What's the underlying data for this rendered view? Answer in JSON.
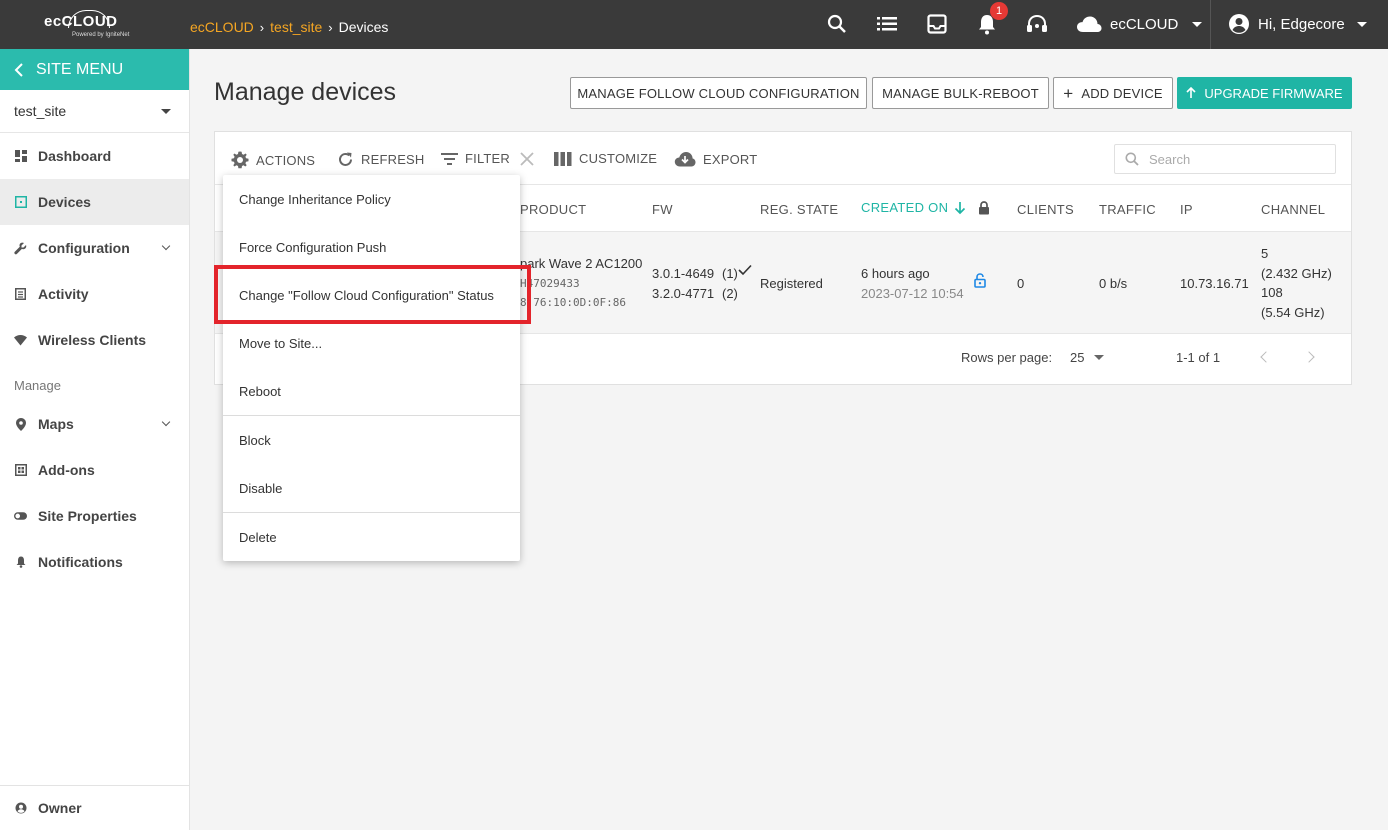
{
  "topbar": {
    "logo_text": "ecCLOUD",
    "logo_sub": "Powered by IgniteNet",
    "breadcrumb": [
      "ecCLOUD",
      "test_site",
      "Devices"
    ],
    "notification_count": "1",
    "cloud_label": "ecCLOUD",
    "user_label": "Hi, Edgecore",
    "icons": [
      "search-icon",
      "list-icon",
      "inbox-icon",
      "bell-icon",
      "support-icon",
      "cloud-icon",
      "account-icon"
    ]
  },
  "sidebar": {
    "header": "SITE MENU",
    "site": "test_site",
    "items": [
      {
        "label": "Dashboard",
        "icon": "dashboard-icon"
      },
      {
        "label": "Devices",
        "icon": "devices-icon"
      },
      {
        "label": "Configuration",
        "icon": "wrench-icon"
      },
      {
        "label": "Activity",
        "icon": "activity-icon"
      },
      {
        "label": "Wireless Clients",
        "icon": "wifi-icon"
      }
    ],
    "section": "Manage",
    "manage_items": [
      {
        "label": "Maps",
        "icon": "pin-icon"
      },
      {
        "label": "Add-ons",
        "icon": "addons-icon"
      },
      {
        "label": "Site Properties",
        "icon": "toggle-icon"
      },
      {
        "label": "Notifications",
        "icon": "bell-icon"
      }
    ],
    "owner": "Owner"
  },
  "main": {
    "title": "Manage devices",
    "buttons": {
      "follow_cloud": "MANAGE FOLLOW CLOUD CONFIGURATION",
      "bulk_reboot": "MANAGE BULK-REBOOT",
      "add_device": "ADD DEVICE",
      "upgrade": "UPGRADE FIRMWARE"
    },
    "toolbar": {
      "actions": "ACTIONS",
      "refresh": "REFRESH",
      "filter": "FILTER",
      "customize": "CUSTOMIZE",
      "export": "EXPORT",
      "search_placeholder": "Search"
    },
    "columns": [
      "PRODUCT",
      "FW",
      "REG. STATE",
      "CREATED ON",
      "CLIENTS",
      "TRAFFIC",
      "IP",
      "CHANNEL"
    ],
    "row": {
      "product": "park Wave 2 AC1200",
      "serial": "H47029433",
      "mac": "8:76:10:0D:0F:86",
      "fw1": "3.0.1-4649",
      "fw1_idx": "(1)",
      "fw2": "3.2.0-4771",
      "fw2_idx": "(2)",
      "reg_state": "Registered",
      "created": "6 hours ago",
      "created_date": "2023-07-12 10:54",
      "clients": "0",
      "traffic": "0 b/s",
      "ip": "10.73.16.71",
      "channel": [
        "5",
        "(2.432 GHz)",
        "108",
        "(5.54 GHz)"
      ]
    },
    "pager": {
      "rows_label": "Rows per page:",
      "rows_value": "25",
      "range": "1-1 of 1"
    }
  },
  "actions_menu": [
    "Change Inheritance Policy",
    "Force Configuration Push",
    "Change \"Follow Cloud Configuration\" Status",
    "Move to Site...",
    "Reboot",
    "Block",
    "Disable",
    "Delete"
  ]
}
